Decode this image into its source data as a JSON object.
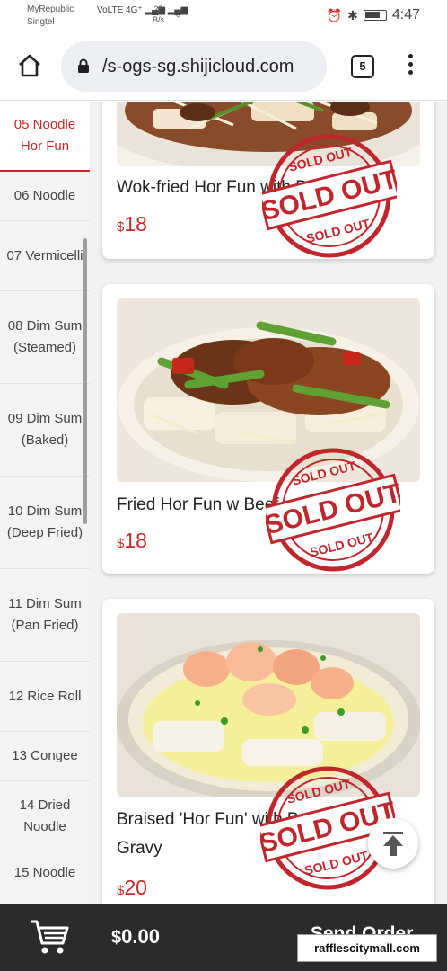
{
  "status_bar": {
    "carrier_line1": "MyRepublic",
    "carrier_line2": "Singtel",
    "signal": "VoLTE 4G⁺ ▂▄▆ ▂▄▆",
    "speed_value": "25",
    "speed_unit": "B/s",
    "time": "4:47"
  },
  "browser": {
    "url": "/s-ogs-sg.shijicloud.com",
    "tab_count": "5"
  },
  "sidebar": {
    "items": [
      {
        "label": "05 Noodle Hor Fun",
        "active": true
      },
      {
        "label": "06 Noodle"
      },
      {
        "label": "07 Vermicelli"
      },
      {
        "label": "08 Dim Sum (Steamed)"
      },
      {
        "label": "09 Dim Sum (Baked)"
      },
      {
        "label": "10 Dim Sum (Deep Fried)"
      },
      {
        "label": "11 Dim Sum (Pan Fried)"
      },
      {
        "label": "12 Rice Roll"
      },
      {
        "label": "13 Congee"
      },
      {
        "label": "14 Dried Noodle"
      },
      {
        "label": "15 Noodle"
      }
    ]
  },
  "menu": {
    "items": [
      {
        "name": "Wok-fried Hor Fun with Beef",
        "currency": "$",
        "price": "18",
        "status": "SOLD OUT"
      },
      {
        "name": "Fried Hor Fun w Beef",
        "currency": "$",
        "price": "18",
        "status": "SOLD OUT"
      },
      {
        "name": "Braised 'Hor Fun' with Prawn in Egg Gravy",
        "currency": "$",
        "price": "20",
        "status": "SOLD OUT"
      }
    ]
  },
  "cart": {
    "currency": "$",
    "total": "0.00",
    "send_label": "Send Order"
  },
  "watermark": "rafflescitymall.com",
  "colors": {
    "accent": "#c62828",
    "stamp": "#c0262c",
    "bottom_bar": "#2b2b2b"
  },
  "icons": [
    "home-icon",
    "lock-icon",
    "more-vert-icon",
    "cart-icon",
    "arrow-up-icon",
    "alarm-icon",
    "bluetooth-icon",
    "battery-icon"
  ]
}
